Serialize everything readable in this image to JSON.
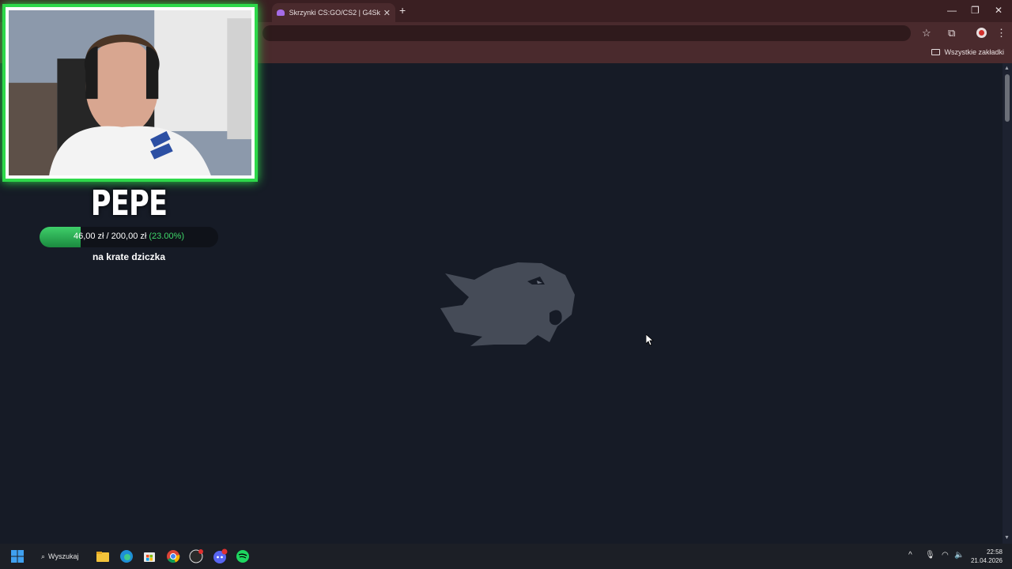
{
  "browser": {
    "tab_title": "Skrzynki CS:GO/CS2 | G4Skins",
    "tab_close": "✕",
    "new_tab": "+",
    "bookmarks_all": "Wszystkie zakładki",
    "window_controls": {
      "minimize": "—",
      "restore": "❐",
      "close": "✕"
    }
  },
  "overlay": {
    "streamer_name": "PEPE",
    "goal_current": "46,00 zł",
    "goal_separator": "/",
    "goal_target": "200,00 zł",
    "goal_percent": "(23.00%)",
    "goal_progress": 0.23,
    "goal_label": "na krate dziczka"
  },
  "taskbar": {
    "search_label": "Wyszukaj",
    "clock_time": "22:58",
    "clock_date": "21.04.2026"
  },
  "colors": {
    "accent_green": "#2ed84a",
    "page_bg": "#161b26",
    "logo_gray": "#454b57",
    "chrome_bg": "#4a2a2d"
  }
}
